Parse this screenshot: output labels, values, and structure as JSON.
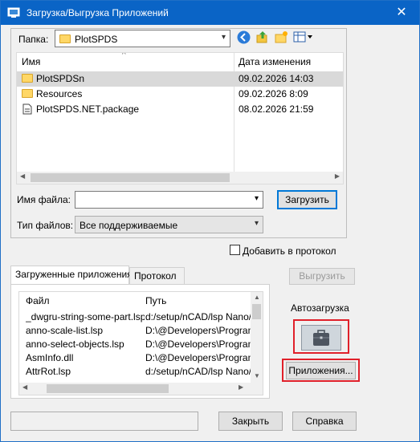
{
  "window": {
    "title": "Загрузка/Выгрузка Приложений",
    "close_glyph": "✕"
  },
  "file_browser": {
    "folder_label": "Папка:",
    "folder_value": "PlotSPDS",
    "columns": {
      "name": "Имя",
      "date": "Дата изменения"
    },
    "sort_indicator": "^",
    "items": [
      {
        "name": "PlotSPDSn",
        "date": "09.02.2026 14:03",
        "icon": "folder-icon",
        "selected": true
      },
      {
        "name": "Resources",
        "date": "09.02.2026 8:09",
        "icon": "folder-icon",
        "selected": false
      },
      {
        "name": "PlotSPDS.NET.package",
        "date": "08.02.2026 21:59",
        "icon": "file-icon",
        "selected": false
      }
    ],
    "filename_label": "Имя файла:",
    "filename_value": "",
    "filetype_label": "Тип файлов:",
    "filetype_value": "Все поддерживаемые",
    "load_button": "Загрузить"
  },
  "add_to_log_label": "Добавить в протокол",
  "add_to_log_checked": false,
  "tabs": [
    {
      "label": "Загруженные приложения",
      "active": true
    },
    {
      "label": "Протокол",
      "active": false
    }
  ],
  "loaded_apps": {
    "columns": {
      "file": "Файл",
      "path": "Путь"
    },
    "rows": [
      {
        "file": "_dwgru-string-some-part.lsp",
        "path": "d:/setup/nCAD/lsp Nano/Dv"
      },
      {
        "file": "anno-scale-list.lsp",
        "path": "D:\\@Developers\\Programm"
      },
      {
        "file": "anno-select-objects.lsp",
        "path": "D:\\@Developers\\Programm"
      },
      {
        "file": "AsmInfo.dll",
        "path": "D:\\@Developers\\Programm"
      },
      {
        "file": "AttrRot.lsp",
        "path": "d:/setup/nCAD/lsp Nano/dr"
      }
    ]
  },
  "unload_button": "Выгрузить",
  "autoload": {
    "label": "Автозагрузка",
    "icon": "briefcase-icon",
    "apps_button": "Приложения..."
  },
  "close_button": "Закрыть",
  "help_button": "Справка",
  "colors": {
    "titlebar": "#0a64c6",
    "highlight_box": "#e0202a",
    "selected_row": "#d9d9d9"
  }
}
